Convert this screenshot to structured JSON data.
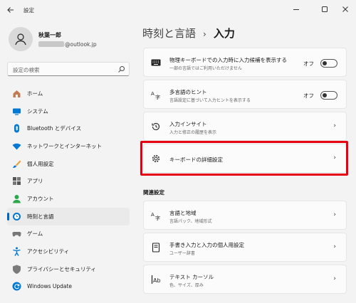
{
  "window": {
    "title": "設定",
    "back_icon": "back-arrow-icon",
    "controls": [
      "minimize-icon",
      "maximize-icon",
      "close-icon"
    ]
  },
  "user": {
    "name": "秋葉一郎",
    "email_suffix": "@outlook.jp"
  },
  "search": {
    "placeholder": "設定の検索"
  },
  "sidebar": {
    "items": [
      {
        "label": "ホーム",
        "icon": "home-icon",
        "color": "#c27b52"
      },
      {
        "label": "システム",
        "icon": "system-icon",
        "color": "#0078d4"
      },
      {
        "label": "Bluetooth とデバイス",
        "icon": "bluetooth-icon",
        "color": "#0078d4"
      },
      {
        "label": "ネットワークとインターネット",
        "icon": "wifi-icon",
        "color": "#0078d4"
      },
      {
        "label": "個人用設定",
        "icon": "brush-icon",
        "color": "#e3a33b"
      },
      {
        "label": "アプリ",
        "icon": "apps-icon",
        "color": "#555555"
      },
      {
        "label": "アカウント",
        "icon": "account-icon",
        "color": "#2aa84a"
      },
      {
        "label": "時刻と言語",
        "icon": "time-language-icon",
        "color": "#0078d4",
        "active": true
      },
      {
        "label": "ゲーム",
        "icon": "gaming-icon",
        "color": "#777777"
      },
      {
        "label": "アクセシビリティ",
        "icon": "accessibility-icon",
        "color": "#0078d4"
      },
      {
        "label": "プライバシーとセキュリティ",
        "icon": "shield-icon",
        "color": "#7a7a7a"
      },
      {
        "label": "Windows Update",
        "icon": "update-icon",
        "color": "#0078d4"
      }
    ]
  },
  "header": {
    "breadcrumb": "時刻と言語",
    "separator": "›",
    "current": "入力"
  },
  "settings": [
    {
      "title": "物理キーボードでの入力時に入力候補を表示する",
      "subtitle": "一部の言語ではご利用いただけません",
      "icon": "keyboard-icon",
      "control": "toggle",
      "toggle_label": "オフ",
      "toggle_on": false
    },
    {
      "title": "多言語のヒント",
      "subtitle": "言語設定に基づいて入力ヒントを表示する",
      "icon": "language-hint-icon",
      "control": "toggle",
      "toggle_label": "オフ",
      "toggle_on": false
    },
    {
      "title": "入力インサイト",
      "subtitle": "入力と修正の履歴を表示",
      "icon": "history-icon",
      "control": "chevron"
    },
    {
      "title": "キーボードの詳細設定",
      "icon": "gear-icon",
      "control": "chevron",
      "highlighted": true
    }
  ],
  "related": {
    "heading": "関連設定",
    "items": [
      {
        "title": "言語と地域",
        "subtitle": "言語パック、地域形式",
        "icon": "language-region-icon"
      },
      {
        "title": "手書き入力と入力の個人用設定",
        "subtitle": "ユーザー辞書",
        "icon": "notebook-icon"
      },
      {
        "title": "テキスト カーソル",
        "subtitle": "色、サイズ、厚み",
        "icon": "text-cursor-icon"
      }
    ]
  },
  "chevron": "›",
  "highlight_color": "#e60012",
  "accent_color": "#0067c0"
}
